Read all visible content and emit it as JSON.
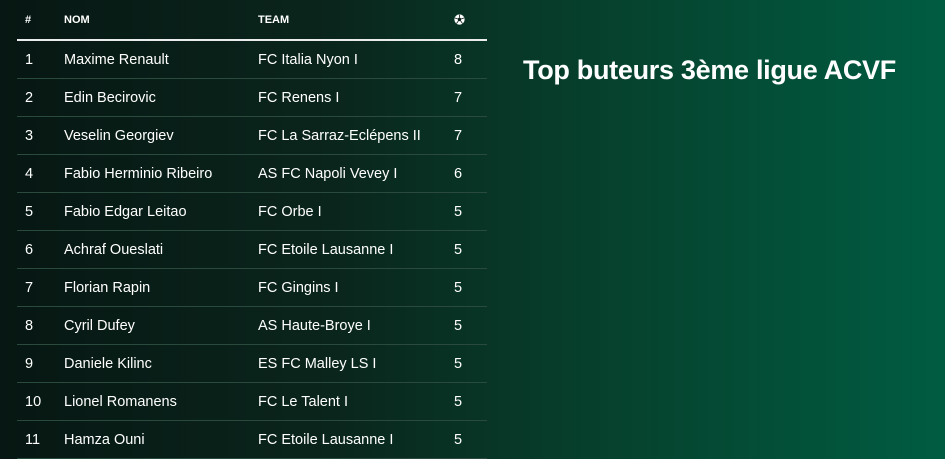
{
  "title": "Top buteurs 3ème ligue ACVF",
  "table": {
    "headers": {
      "rank": "#",
      "name": "NOM",
      "team": "TEAM",
      "goals_icon": "soccer-ball-icon"
    },
    "rows": [
      {
        "rank": "1",
        "name": "Maxime Renault",
        "team": "FC Italia Nyon I",
        "goals": "8"
      },
      {
        "rank": "2",
        "name": "Edin Becirovic",
        "team": "FC Renens I",
        "goals": "7"
      },
      {
        "rank": "3",
        "name": "Veselin Georgiev",
        "team": "FC La Sarraz-Eclépens II",
        "goals": "7"
      },
      {
        "rank": "4",
        "name": "Fabio Herminio Ribeiro",
        "team": "AS FC Napoli Vevey I",
        "goals": "6"
      },
      {
        "rank": "5",
        "name": "Fabio Edgar Leitao",
        "team": "FC Orbe I",
        "goals": "5"
      },
      {
        "rank": "6",
        "name": "Achraf Oueslati",
        "team": "FC Etoile Lausanne I",
        "goals": "5"
      },
      {
        "rank": "7",
        "name": "Florian Rapin",
        "team": "FC Gingins I",
        "goals": "5"
      },
      {
        "rank": "8",
        "name": "Cyril Dufey",
        "team": "AS Haute-Broye I",
        "goals": "5"
      },
      {
        "rank": "9",
        "name": "Daniele Kilinc",
        "team": "ES FC Malley LS I",
        "goals": "5"
      },
      {
        "rank": "10",
        "name": "Lionel Romanens",
        "team": "FC Le Talent I",
        "goals": "5"
      },
      {
        "rank": "11",
        "name": "Hamza Ouni",
        "team": "FC Etoile Lausanne I",
        "goals": "5"
      }
    ]
  },
  "colors": {
    "background_dark": "#071713",
    "background_light": "#005c41",
    "text": "#ffffff",
    "row_divider": "#2b4a3e"
  }
}
